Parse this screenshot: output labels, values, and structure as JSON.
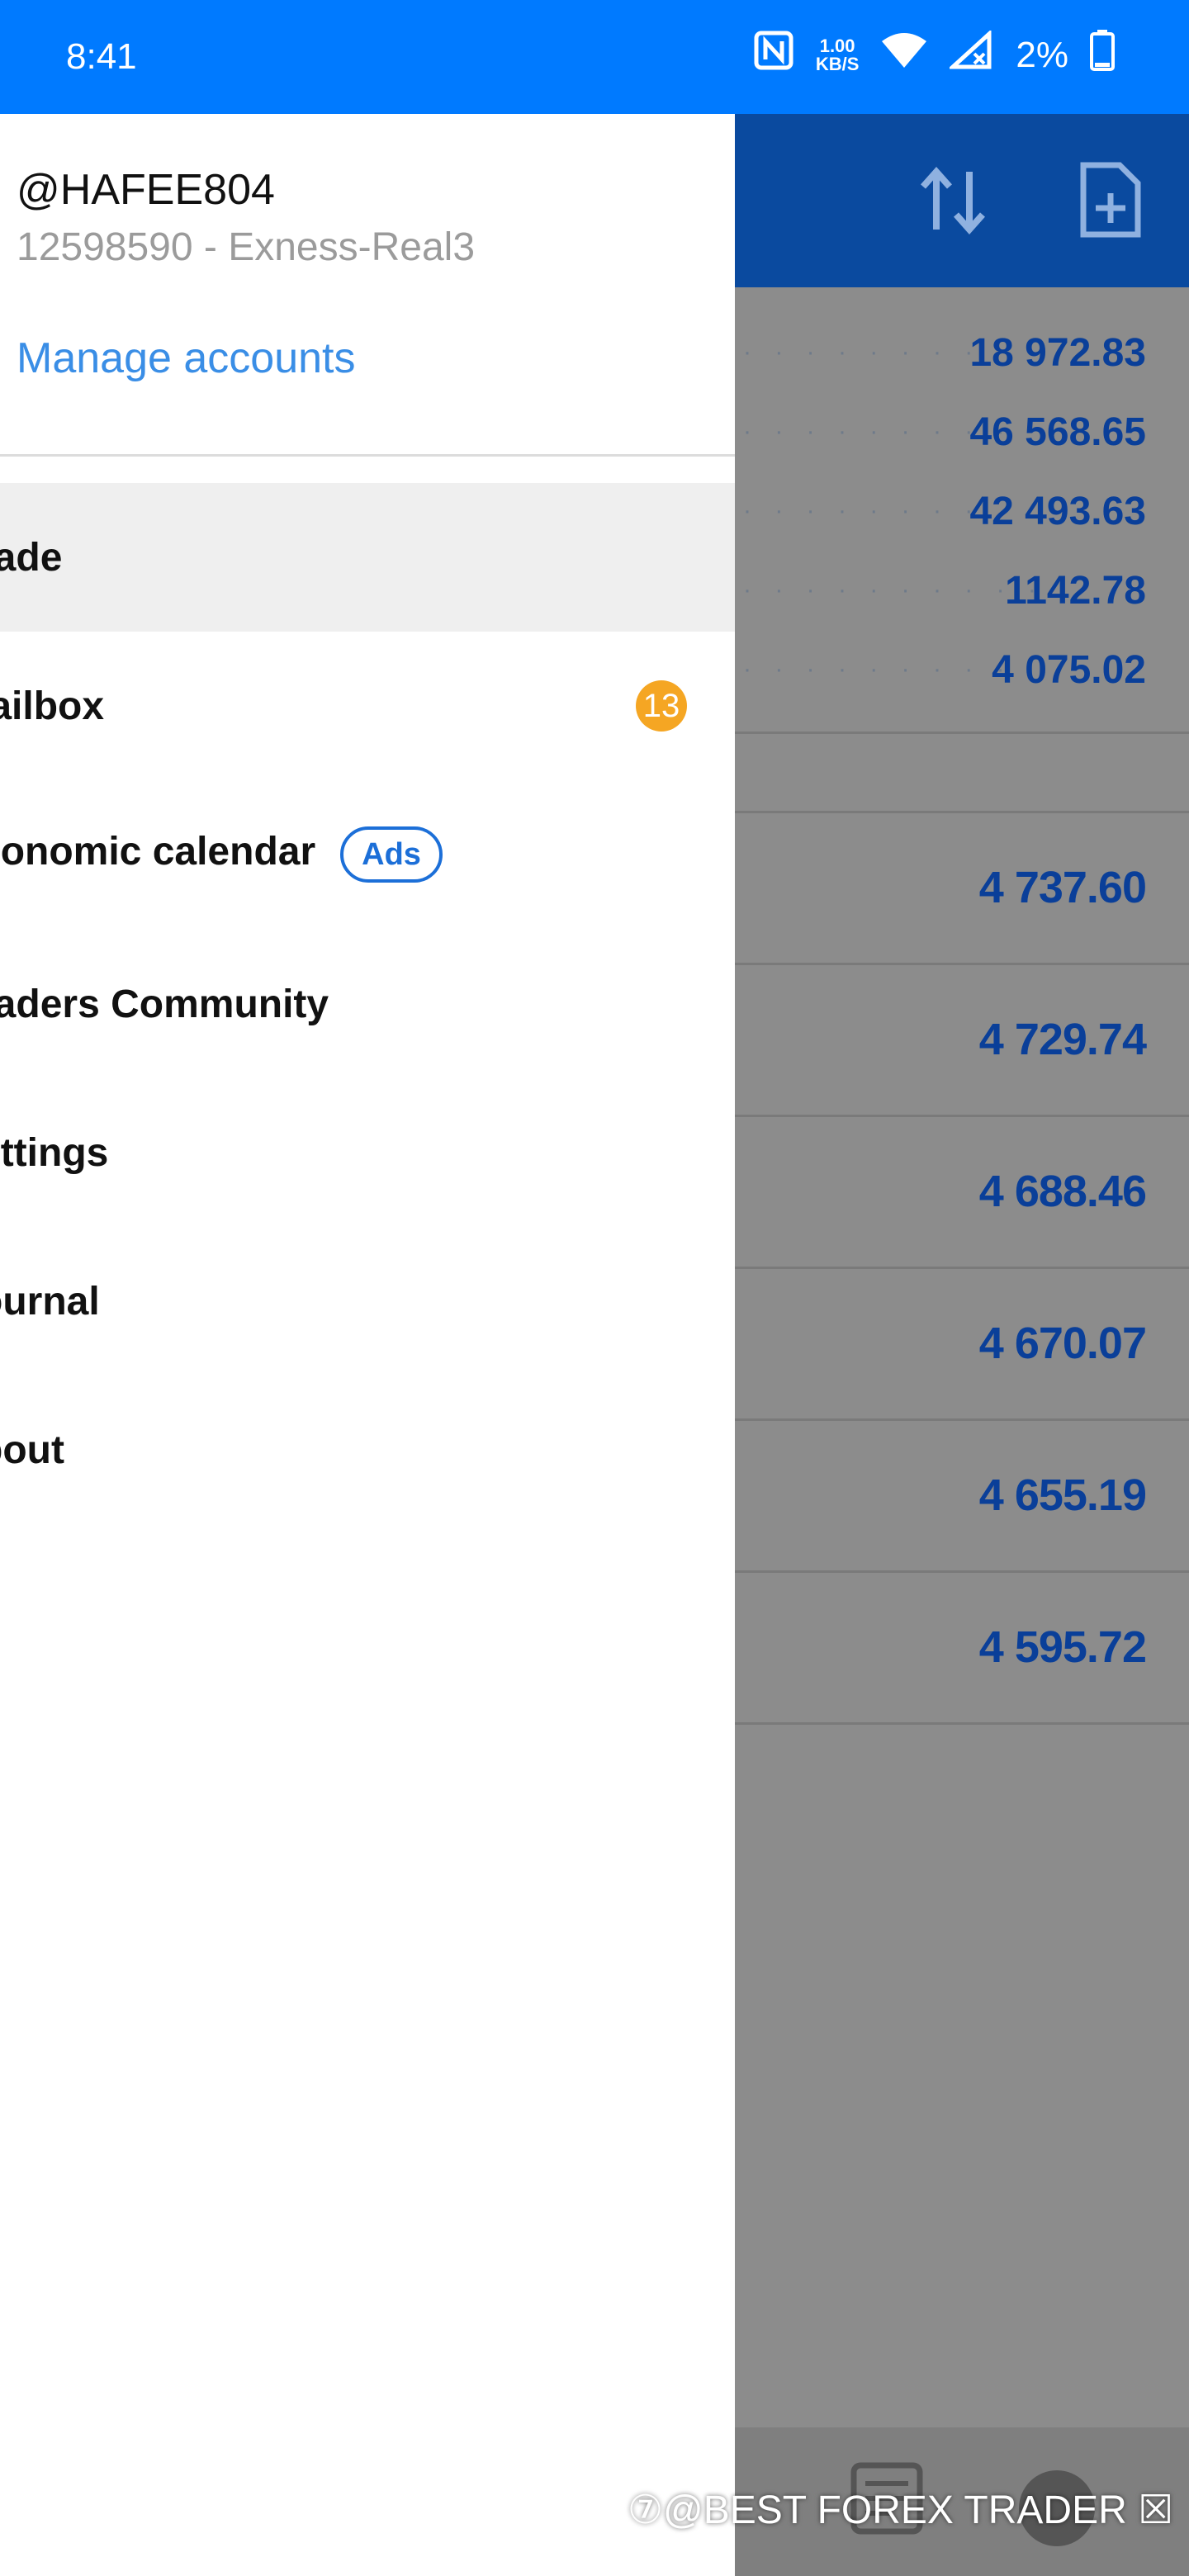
{
  "status_bar": {
    "time": "8:41",
    "net_speed_value": "1.00",
    "net_speed_unit": "KB/S",
    "battery": "2%"
  },
  "account": {
    "name": "@HAFEE804",
    "number": "12598590 - Exness-Real3",
    "manage_label": "Manage accounts"
  },
  "menu": {
    "trade": "rade",
    "mailbox": "lailbox",
    "mailbox_badge": "13",
    "economic_calendar": "conomic calendar",
    "ads_label": "Ads",
    "traders_community": "raders Community",
    "settings": "ettings",
    "journal": "ournal",
    "about": "bout"
  },
  "background": {
    "quotes": [
      "18 972.83",
      "46 568.65",
      "42 493.63",
      "1142.78",
      "4 075.02"
    ],
    "prices": [
      "4 737.60",
      "4 729.74",
      "4 688.46",
      "4 670.07",
      "4 655.19",
      "4 595.72"
    ]
  },
  "watermark": "⑦@BEST FOREX TRADER ☒",
  "colors": {
    "status_bar": "#007aff",
    "toolbar": "#0a4a9f",
    "badge": "#f5a623",
    "link": "#3a8ee6"
  }
}
